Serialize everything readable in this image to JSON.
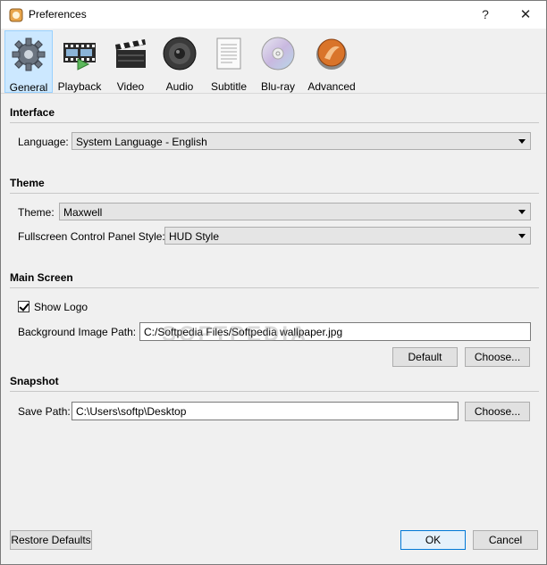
{
  "window": {
    "title": "Preferences",
    "help_glyph": "?",
    "close_glyph": "✕"
  },
  "toolbar": {
    "tabs": [
      {
        "label": "General",
        "icon": "gear-icon",
        "active": true
      },
      {
        "label": "Playback",
        "icon": "film-strip-icon"
      },
      {
        "label": "Video",
        "icon": "clapperboard-icon"
      },
      {
        "label": "Audio",
        "icon": "speaker-icon"
      },
      {
        "label": "Subtitle",
        "icon": "document-icon"
      },
      {
        "label": "Blu-ray",
        "icon": "disc-icon"
      },
      {
        "label": "Advanced",
        "icon": "advanced-icon"
      }
    ]
  },
  "interface": {
    "heading": "Interface",
    "language_label": "Language:",
    "language_value": "System Language - English"
  },
  "theme": {
    "heading": "Theme",
    "theme_label": "Theme:",
    "theme_value": "Maxwell",
    "panel_label": "Fullscreen Control Panel Style:",
    "panel_value": "HUD Style"
  },
  "main_screen": {
    "heading": "Main Screen",
    "show_logo_label": "Show Logo",
    "show_logo_checked": true,
    "bg_label": "Background Image Path:",
    "bg_value": "C:/Softpedia Files/Softpedia wallpaper.jpg",
    "default_button": "Default",
    "choose_button": "Choose..."
  },
  "snapshot": {
    "heading": "Snapshot",
    "save_label": "Save Path:",
    "save_value": "C:\\Users\\softp\\Desktop",
    "choose_button": "Choose..."
  },
  "footer": {
    "restore_button": "Restore Defaults",
    "ok_button": "OK",
    "cancel_button": "Cancel"
  },
  "watermark": "SOFTPEDIA",
  "colors": {
    "active_tab_bg": "#cce8ff",
    "active_tab_border": "#99d1ff",
    "primary_border": "#0078d7"
  }
}
